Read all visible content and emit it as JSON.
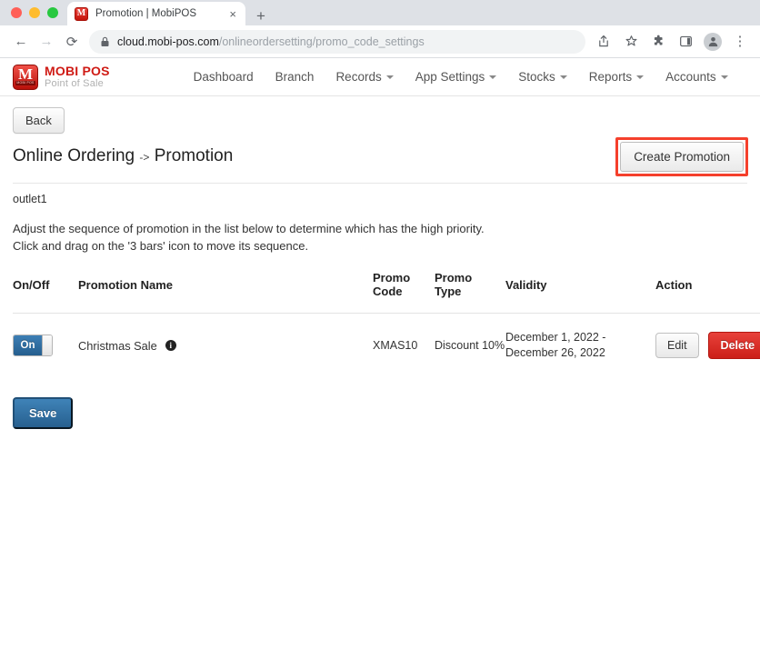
{
  "browser": {
    "tab": {
      "title": "Promotion | MobiPOS",
      "favicon_letter": "M",
      "close_label": "×"
    },
    "new_tab_label": "+",
    "nav": {
      "back": "←",
      "forward": "→",
      "reload": "⟳"
    },
    "omnibox": {
      "host": "cloud.mobi-pos.com",
      "path": "/onlineordersetting/promo_code_settings"
    },
    "toolbar_icons": [
      "share-icon",
      "bookmark-star-icon",
      "extensions-puzzle-icon",
      "side-panel-icon",
      "profile-avatar-icon",
      "chrome-menu-icon"
    ],
    "kebab": "⋮"
  },
  "site": {
    "brand": {
      "title": "MOBI POS",
      "subtitle": "Point of Sale",
      "mark_letter": "M",
      "mark_sub": "MOBI POS"
    },
    "nav_items": [
      {
        "label": "Dashboard",
        "has_caret": false
      },
      {
        "label": "Branch",
        "has_caret": false
      },
      {
        "label": "Records",
        "has_caret": true
      },
      {
        "label": "App Settings",
        "has_caret": true
      },
      {
        "label": "Stocks",
        "has_caret": true
      },
      {
        "label": "Reports",
        "has_caret": true
      },
      {
        "label": "Accounts",
        "has_caret": true
      }
    ]
  },
  "page": {
    "back_label": "Back",
    "title_main": "Online Ordering",
    "title_arrow": "->",
    "title_sub": "Promotion",
    "create_button": "Create Promotion",
    "outlet": "outlet1",
    "note_line1": "Adjust the sequence of promotion in the list below to determine which has the high priority.",
    "note_line2": "Click and drag on the '3 bars' icon to move its sequence.",
    "save_label": "Save"
  },
  "table": {
    "headers": {
      "onoff": "On/Off",
      "name": "Promotion Name",
      "code_line1": "Promo",
      "code_line2": "Code",
      "type_line1": "Promo",
      "type_line2": "Type",
      "validity": "Validity",
      "action": "Action"
    },
    "rows": [
      {
        "toggle_state": "On",
        "name": "Christmas Sale",
        "info_icon": "i",
        "code": "XMAS10",
        "type": "Discount 10%",
        "validity": "December 1, 2022 - December 26, 2022",
        "edit_label": "Edit",
        "delete_label": "Delete"
      }
    ]
  },
  "colors": {
    "brand_red": "#cf1b15",
    "highlight_border": "#f5402c",
    "toggle_blue": "#2a6699",
    "delete_red": "#d8271f",
    "save_blue": "#2f6e9f"
  }
}
